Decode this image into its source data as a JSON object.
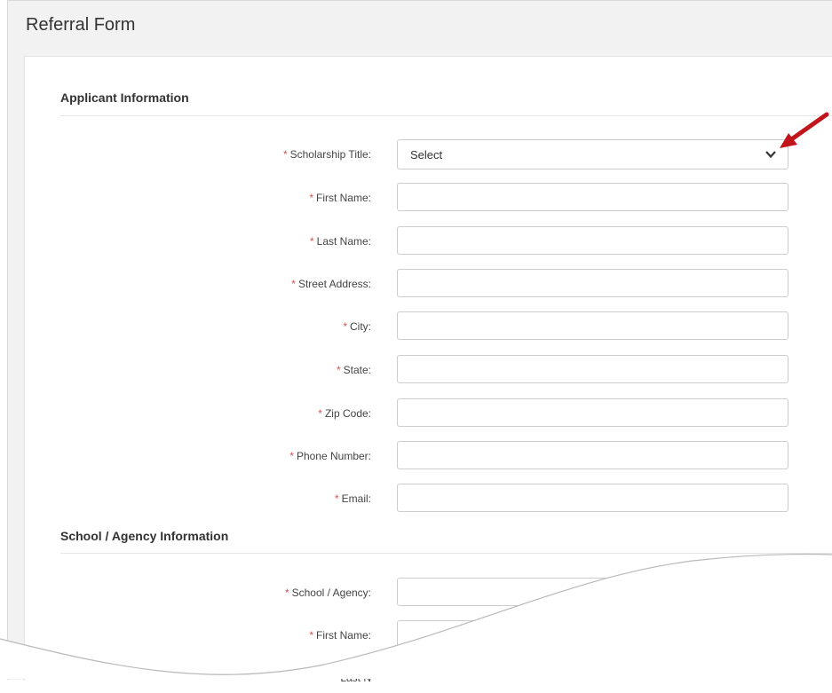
{
  "page": {
    "title": "Referral Form"
  },
  "sections": {
    "applicant": {
      "title": "Applicant Information"
    },
    "school": {
      "title": "School / Agency Information"
    }
  },
  "required_marker": "*",
  "applicant_fields": {
    "scholarship_title": {
      "label": "Scholarship Title:",
      "value": "Select"
    },
    "first_name": {
      "label": "First Name:",
      "value": ""
    },
    "last_name": {
      "label": "Last Name:",
      "value": ""
    },
    "street_address": {
      "label": "Street Address:",
      "value": ""
    },
    "city": {
      "label": "City:",
      "value": ""
    },
    "state": {
      "label": "State:",
      "value": ""
    },
    "zip_code": {
      "label": "Zip Code:",
      "value": ""
    },
    "phone_number": {
      "label": "Phone Number:",
      "value": ""
    },
    "email": {
      "label": "Email:",
      "value": ""
    }
  },
  "school_fields": {
    "school_agency": {
      "label": "School / Agency:",
      "value": ""
    },
    "first_name": {
      "label": "First Name:",
      "value": ""
    },
    "last_name_partial": {
      "label": "Last N",
      "value": ""
    }
  },
  "colors": {
    "required": "#d9534f",
    "annotation_arrow": "#c0161b"
  },
  "icons": {
    "dropdown": "chevron-down-icon",
    "annotation": "red-arrow-icon"
  }
}
